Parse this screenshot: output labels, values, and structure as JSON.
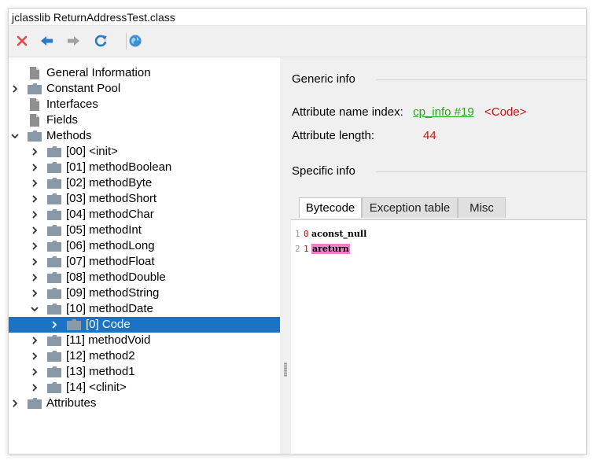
{
  "window": {
    "title": "jclasslib ReturnAddressTest.class"
  },
  "toolbar": {
    "buttons": [
      {
        "name": "close-button",
        "icon": "red-x-icon",
        "color": "#e04848"
      },
      {
        "name": "back-button",
        "icon": "arrow-left-icon",
        "color": "#2a79c8"
      },
      {
        "name": "forward-button",
        "icon": "arrow-right-icon",
        "color": "#a0a0a0"
      },
      {
        "name": "reload-button",
        "icon": "refresh-icon",
        "color": "#2a79c8"
      },
      {
        "name": "browser-button",
        "icon": "globe-icon",
        "color": "#3f8fd6"
      }
    ]
  },
  "tree": {
    "items": [
      {
        "label": "General Information",
        "expand": "none",
        "icon": "doc-icon",
        "level": 0
      },
      {
        "label": "Constant Pool",
        "expand": "collapsed",
        "icon": "folder-icon",
        "level": 0
      },
      {
        "label": "Interfaces",
        "expand": "none",
        "icon": "doc-icon",
        "level": 0
      },
      {
        "label": "Fields",
        "expand": "none",
        "icon": "doc-icon",
        "level": 0
      },
      {
        "label": "Methods",
        "expand": "expanded",
        "icon": "folder-icon",
        "level": 0
      },
      {
        "label": "[00] <init>",
        "expand": "collapsed",
        "icon": "folder-icon",
        "level": 1
      },
      {
        "label": "[01] methodBoolean",
        "expand": "collapsed",
        "icon": "folder-icon",
        "level": 1
      },
      {
        "label": "[02] methodByte",
        "expand": "collapsed",
        "icon": "folder-icon",
        "level": 1
      },
      {
        "label": "[03] methodShort",
        "expand": "collapsed",
        "icon": "folder-icon",
        "level": 1
      },
      {
        "label": "[04] methodChar",
        "expand": "collapsed",
        "icon": "folder-icon",
        "level": 1
      },
      {
        "label": "[05] methodInt",
        "expand": "collapsed",
        "icon": "folder-icon",
        "level": 1
      },
      {
        "label": "[06] methodLong",
        "expand": "collapsed",
        "icon": "folder-icon",
        "level": 1
      },
      {
        "label": "[07] methodFloat",
        "expand": "collapsed",
        "icon": "folder-icon",
        "level": 1
      },
      {
        "label": "[08] methodDouble",
        "expand": "collapsed",
        "icon": "folder-icon",
        "level": 1
      },
      {
        "label": "[09] methodString",
        "expand": "collapsed",
        "icon": "folder-icon",
        "level": 1
      },
      {
        "label": "[10] methodDate",
        "expand": "expanded",
        "icon": "folder-icon",
        "level": 1
      },
      {
        "label": "[0] Code",
        "expand": "collapsed",
        "icon": "folder-icon",
        "level": 2,
        "selected": true
      },
      {
        "label": "[11] methodVoid",
        "expand": "collapsed",
        "icon": "folder-icon",
        "level": 1
      },
      {
        "label": "[12] method2",
        "expand": "collapsed",
        "icon": "folder-icon",
        "level": 1
      },
      {
        "label": "[13] method1",
        "expand": "collapsed",
        "icon": "folder-icon",
        "level": 1
      },
      {
        "label": "[14] <clinit>",
        "expand": "collapsed",
        "icon": "folder-icon",
        "level": 1
      },
      {
        "label": "Attributes",
        "expand": "collapsed",
        "icon": "folder-icon",
        "level": 0
      }
    ]
  },
  "detail": {
    "generic_title": "Generic info",
    "name_index_label": "Attribute name index:",
    "name_index_link": "cp_info #19",
    "name_index_value": "<Code>",
    "length_label": "Attribute length:",
    "length_value": "44",
    "specific_title": "Specific info",
    "tabs": [
      {
        "label": "Bytecode",
        "active": true
      },
      {
        "label": "Exception table",
        "active": false
      },
      {
        "label": "Misc",
        "active": false
      }
    ],
    "bytecode": [
      {
        "line": "1",
        "offset": "0",
        "instruction": "aconst_null",
        "highlight": false
      },
      {
        "line": "2",
        "offset": "1",
        "instruction": "areturn",
        "highlight": true
      }
    ]
  },
  "colors": {
    "selection": "#1a73c4",
    "link": "#22a822",
    "value": "#cc1111",
    "highlight": "#ee7fc8",
    "folder": "#8a99a8"
  }
}
